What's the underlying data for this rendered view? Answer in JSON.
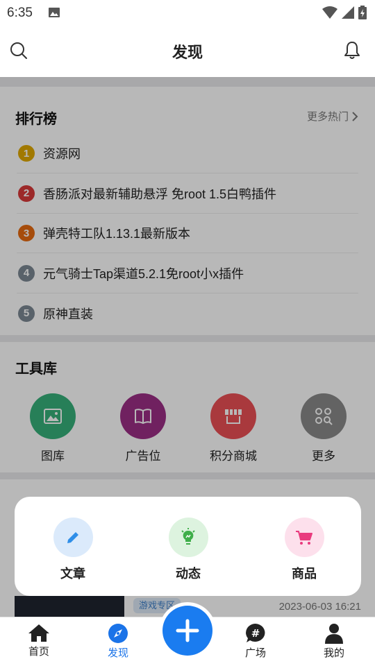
{
  "status": {
    "time": "6:35"
  },
  "header": {
    "title": "发现"
  },
  "ranking": {
    "title": "排行榜",
    "more": "更多热门",
    "items": [
      {
        "num": "1",
        "label": "资源网",
        "color": "#e0a800"
      },
      {
        "num": "2",
        "label": "香肠派对最新辅助悬浮 免root 1.5白鸭插件",
        "color": "#d93a3a"
      },
      {
        "num": "3",
        "label": "弹壳特工队1.13.1最新版本",
        "color": "#e66a10"
      },
      {
        "num": "4",
        "label": "元气骑士Tap渠道5.2.1免root小x插件",
        "color": "#7c8894"
      },
      {
        "num": "5",
        "label": "原神直装",
        "color": "#7c8894"
      }
    ]
  },
  "tools": {
    "title": "工具库",
    "items": [
      {
        "label": "图库",
        "color": "#36b07a",
        "icon": "image-icon"
      },
      {
        "label": "广告位",
        "color": "#9b2f86",
        "icon": "book-icon"
      },
      {
        "label": "积分商城",
        "color": "#ea4f55",
        "icon": "store-icon"
      },
      {
        "label": "更多",
        "color": "#8a8a8a",
        "icon": "grid-search-icon"
      }
    ]
  },
  "popup": {
    "items": [
      {
        "label": "文章",
        "bg": "#dbeafb",
        "fg": "#2f8ee8",
        "icon": "pencil-icon"
      },
      {
        "label": "动态",
        "bg": "#ddf3df",
        "fg": "#3fae4a",
        "icon": "bulb-icon"
      },
      {
        "label": "商品",
        "bg": "#fde0ec",
        "fg": "#e93b7e",
        "icon": "cart-icon"
      }
    ]
  },
  "peek": {
    "tag": "游戏专区",
    "date": "2023-06-03 16:21"
  },
  "nav": {
    "items": [
      {
        "label": "首页",
        "active": false
      },
      {
        "label": "发现",
        "active": true
      },
      {
        "label": "广场",
        "active": false
      },
      {
        "label": "我的",
        "active": false
      }
    ]
  },
  "colors": {
    "accent": "#1a7cf0"
  }
}
